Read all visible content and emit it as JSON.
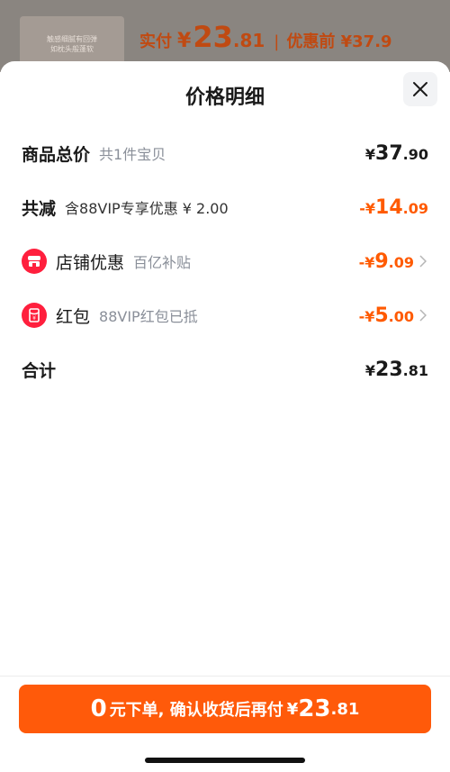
{
  "background": {
    "thumb_lines": [
      "触感细腻有回弹",
      "如枕头般蓬软"
    ],
    "pay_label": "实付",
    "pay_currency": "¥",
    "pay_int": "23",
    "pay_dec": ".81",
    "separator": "|",
    "original_label": "优惠前 ¥37.9"
  },
  "sheet": {
    "title": "价格明细",
    "close_icon": "close-icon"
  },
  "rows": {
    "total": {
      "title": "商品总价",
      "sub": "共1件宝贝",
      "cur": "¥",
      "int": "37",
      "dec": ".90"
    },
    "reduction": {
      "title": "共减",
      "sub": "含88VIP专享优惠 ¥ 2.00",
      "cur": "-¥",
      "int": "14",
      "dec": ".09"
    },
    "shop": {
      "icon": "shop-icon",
      "title": "店铺优惠",
      "sub": "百亿补贴",
      "cur": "-¥",
      "int": "9",
      "dec": ".09"
    },
    "redpacket": {
      "icon": "red-packet-icon",
      "title": "红包",
      "sub": "88VIP红包已抵",
      "cur": "-¥",
      "int": "5",
      "dec": ".00"
    },
    "sum": {
      "title": "合计",
      "cur": "¥",
      "int": "23",
      "dec": ".81"
    }
  },
  "cta": {
    "zero": "0",
    "text": "元下单, 确认收货后再付",
    "cur": "¥",
    "int": "23",
    "dec": ".81"
  },
  "colors": {
    "accent": "#ff5a0a",
    "discount": "#ff5a00",
    "badge": "#ff1f3d"
  }
}
